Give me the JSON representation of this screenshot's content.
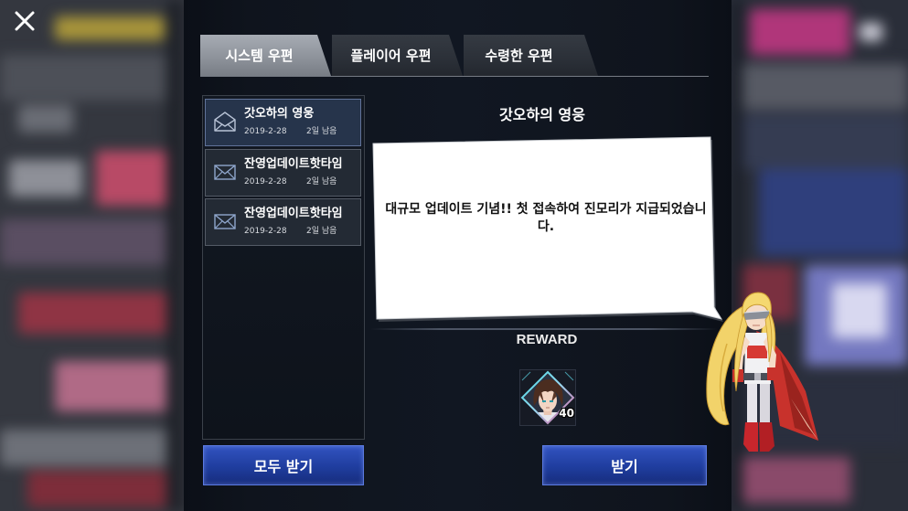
{
  "header": {
    "close_icon": "close-icon"
  },
  "tabs": [
    {
      "label": "시스템 우편",
      "active": true
    },
    {
      "label": "플레이어 우편",
      "active": false
    },
    {
      "label": "수령한 우편",
      "active": false
    }
  ],
  "mail_list": [
    {
      "icon": "envelope-open-icon",
      "title": "갓오하의 영웅",
      "date": "2019-2-28",
      "remaining": "2일 남음",
      "selected": true
    },
    {
      "icon": "envelope-icon",
      "title": "잔영업데이트핫타임",
      "date": "2019-2-28",
      "remaining": "2일 남음",
      "selected": false
    },
    {
      "icon": "envelope-icon",
      "title": "잔영업데이트핫타임",
      "date": "2019-2-28",
      "remaining": "2일 남음",
      "selected": false
    }
  ],
  "detail": {
    "title": "갓오하의 영웅",
    "message": "대규모 업데이트 기념!! 첫 접속하여 진모리가 지급되었습니다.",
    "reward_label": "REWARD",
    "rewards": [
      {
        "icon": "character-portrait-icon",
        "count": "40"
      }
    ]
  },
  "buttons": {
    "receive_all": "모두 받기",
    "receive": "받기"
  },
  "colors": {
    "panel_bg": "#0f141d",
    "tab_active": "#8e939b",
    "tab_inactive": "#2b3038",
    "selected_item": "#26344b",
    "button_blue": "#1f3d9e",
    "button_border": "#5b7ae0",
    "bubble": "#ffffff"
  }
}
